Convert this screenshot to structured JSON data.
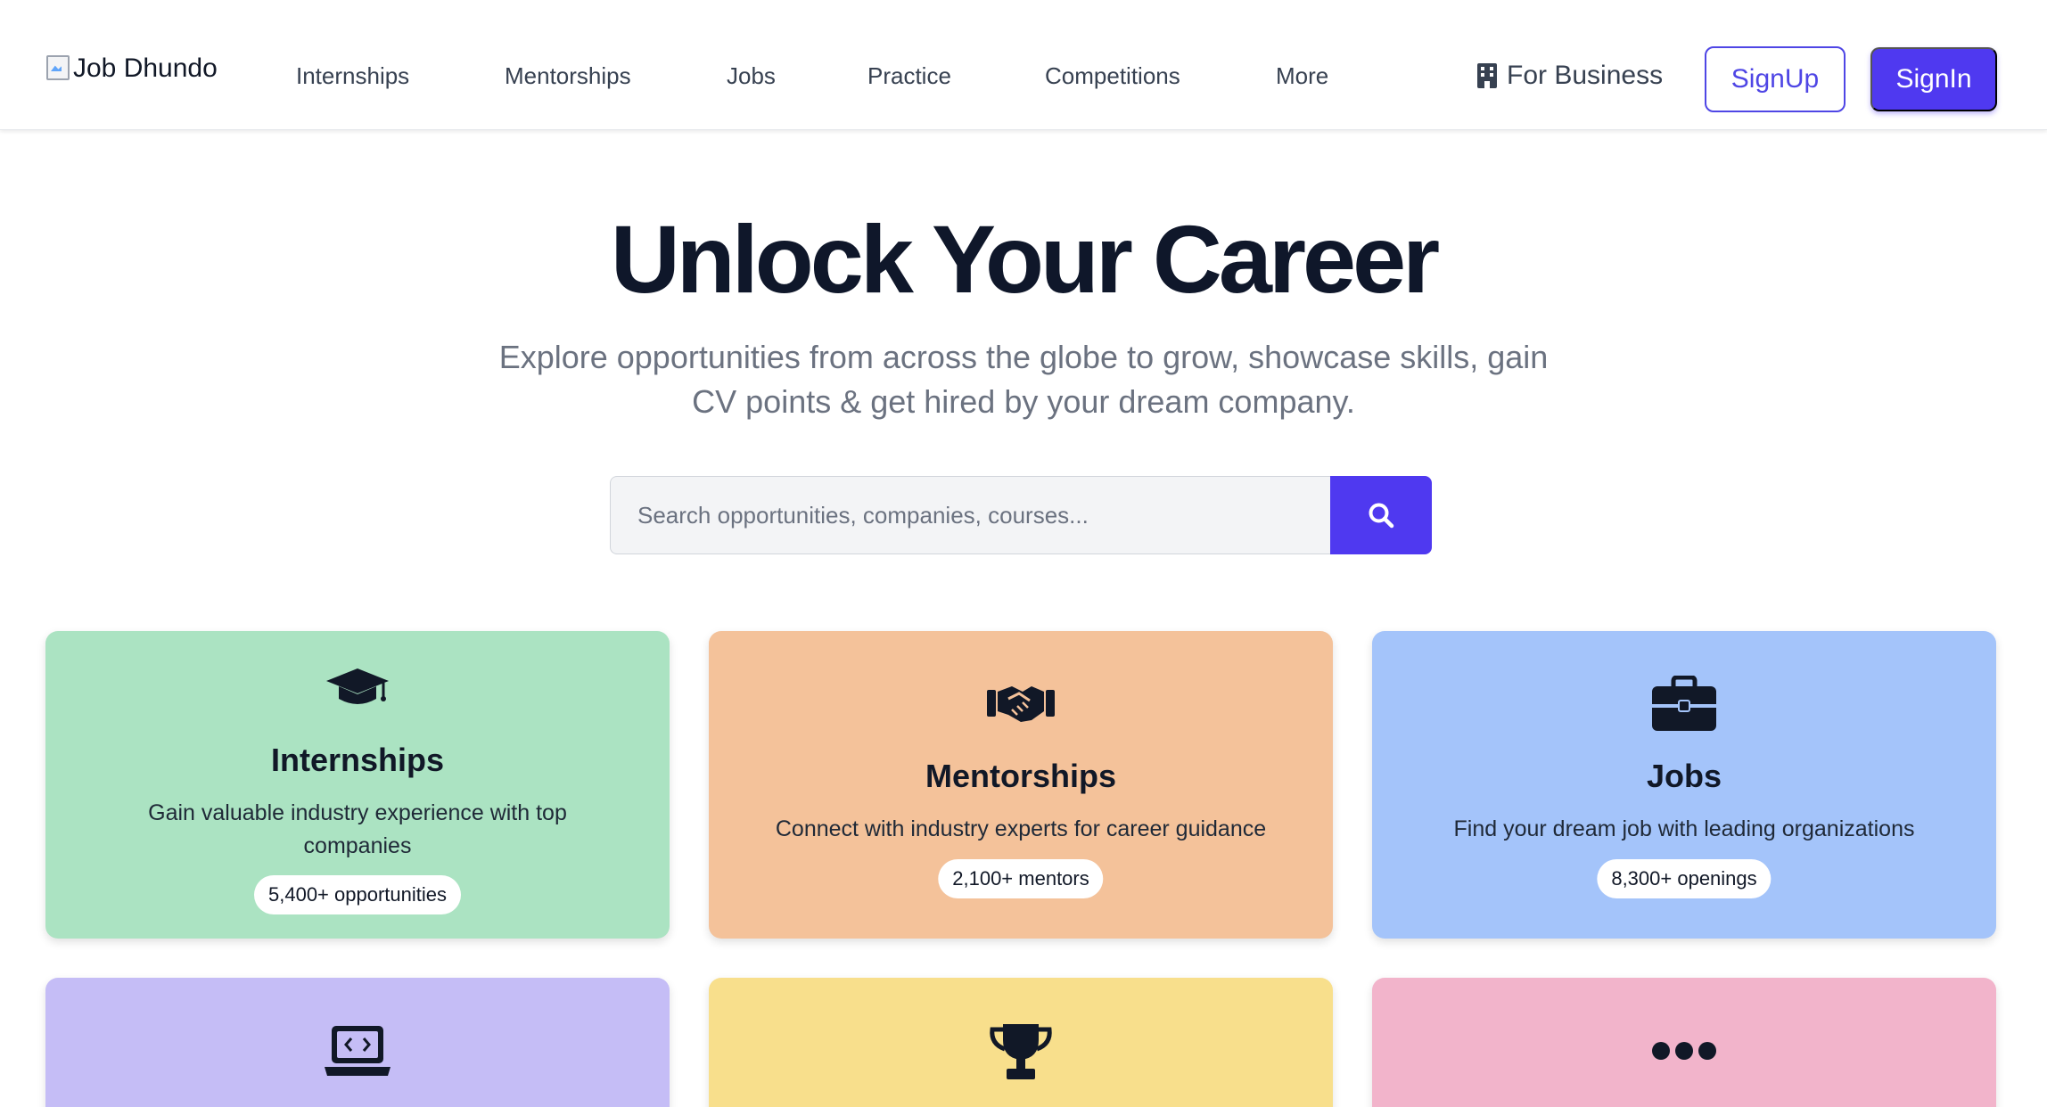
{
  "header": {
    "logo_alt": "Job Dhundo",
    "nav": {
      "internships": "Internships",
      "mentorships": "Mentorships",
      "jobs": "Jobs",
      "practice": "Practice",
      "competitions": "Competitions",
      "more": "More"
    },
    "for_business": "For Business",
    "signup_label": "SignUp",
    "signin_label": "SignIn"
  },
  "hero": {
    "title": "Unlock Your Career",
    "subtitle": "Explore opportunities from across the globe to grow, showcase skills, gain CV points & get hired by your dream company."
  },
  "search": {
    "placeholder": "Search opportunities, companies, courses...",
    "button_icon": "search-icon"
  },
  "cards": {
    "internships": {
      "icon": "graduation-cap-icon",
      "title": "Internships",
      "description": "Gain valuable industry experience with top companies",
      "badge": "5,400+ opportunities",
      "color": "#abe3c2"
    },
    "mentorships": {
      "icon": "handshake-icon",
      "title": "Mentorships",
      "description": "Connect with industry experts for career guidance",
      "badge": "2,100+ mentors",
      "color": "#f4c29a"
    },
    "jobs": {
      "icon": "briefcase-icon",
      "title": "Jobs",
      "description": "Find your dream job with leading organizations",
      "badge": "8,300+ openings",
      "color": "#a4c4fa"
    },
    "practice": {
      "icon": "laptop-code-icon",
      "color": "#c5bdf6"
    },
    "competitions": {
      "icon": "trophy-icon",
      "color": "#f8df8c"
    },
    "more": {
      "icon": "ellipsis-icon",
      "color": "#f2b4cb"
    }
  },
  "colors": {
    "accent": "#4f39f0",
    "heading": "#0f172a",
    "muted": "#6b7280"
  }
}
